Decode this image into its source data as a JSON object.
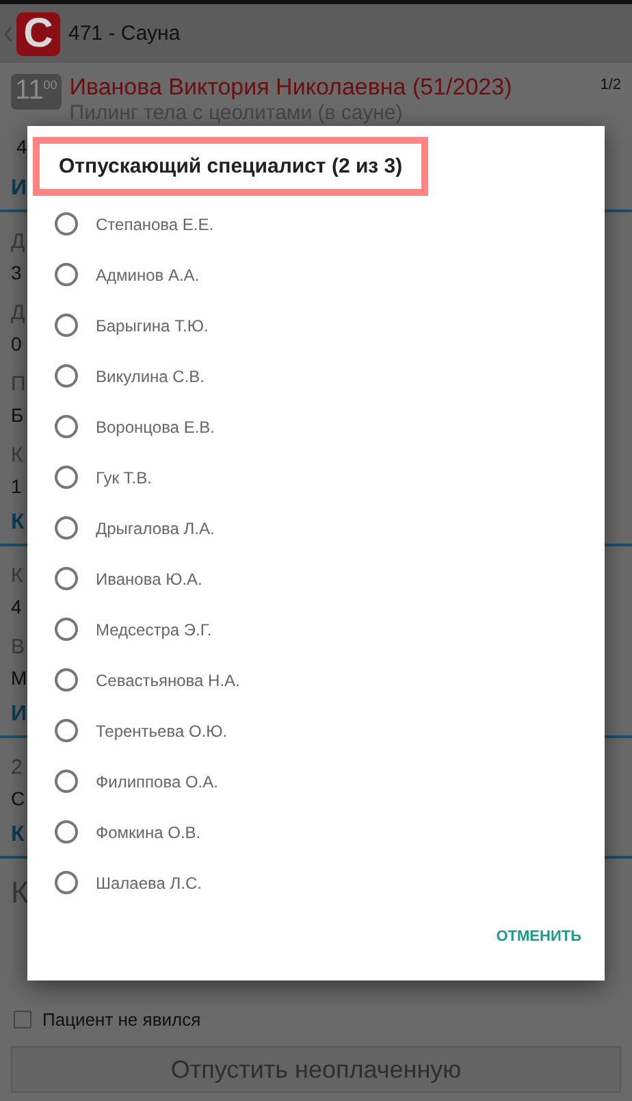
{
  "app_bar": {
    "logo_letter": "С",
    "title": "471 - Сауна"
  },
  "appointment": {
    "time": "11",
    "time_minutes": "00",
    "client": "Иванова Виктория Николаевна (51/2023)",
    "service": "Пилинг тела с цеолитами (в сауне)",
    "counter": "1/2",
    "line_fragment": "4"
  },
  "form_fragments": [
    {
      "kind": "header",
      "text": "И"
    },
    {
      "kind": "label",
      "text": "Д"
    },
    {
      "kind": "value",
      "text": "3"
    },
    {
      "kind": "label",
      "text": "Д"
    },
    {
      "kind": "value",
      "text": "0"
    },
    {
      "kind": "label",
      "text": "П"
    },
    {
      "kind": "value",
      "text": "Б"
    },
    {
      "kind": "label",
      "text": "К"
    },
    {
      "kind": "value",
      "text": "1"
    },
    {
      "kind": "header",
      "text": "К"
    },
    {
      "kind": "label",
      "text": "К"
    },
    {
      "kind": "value",
      "text": "4"
    },
    {
      "kind": "label",
      "text": "В"
    },
    {
      "kind": "value",
      "text": "М"
    },
    {
      "kind": "header",
      "text": "И"
    },
    {
      "kind": "label",
      "text": "2"
    },
    {
      "kind": "value",
      "text": "С"
    },
    {
      "kind": "header",
      "text": "К"
    },
    {
      "kind": "field",
      "text": "К"
    }
  ],
  "no_show": {
    "label": "Пациент не явился",
    "checked": false
  },
  "release_button": {
    "label": "Отпустить неоплаченную",
    "disabled": true
  },
  "dialog": {
    "title": "Отпускающий специалист (2 из 3)",
    "title_highlighted": true,
    "options": [
      {
        "label": "Степанова Е.Е.",
        "selected": false
      },
      {
        "label": "Админов А.А.",
        "selected": false
      },
      {
        "label": "Барыгина Т.Ю.",
        "selected": false
      },
      {
        "label": "Викулина С.В.",
        "selected": false
      },
      {
        "label": "Воронцова Е.В.",
        "selected": false
      },
      {
        "label": "Гук Т.В.",
        "selected": false
      },
      {
        "label": "Дрыгалова Л.А.",
        "selected": false
      },
      {
        "label": "Иванова Ю.А.",
        "selected": false
      },
      {
        "label": "Медсестра Э.Г.",
        "selected": false
      },
      {
        "label": "Севастьянова Н.А.",
        "selected": false
      },
      {
        "label": "Терентьева О.Ю.",
        "selected": false
      },
      {
        "label": "Филиппова О.А.",
        "selected": false
      },
      {
        "label": "Фомкина О.В.",
        "selected": false
      },
      {
        "label": "Шалаева Л.С.",
        "selected": false
      }
    ],
    "cancel": "ОТМЕНИТЬ"
  }
}
